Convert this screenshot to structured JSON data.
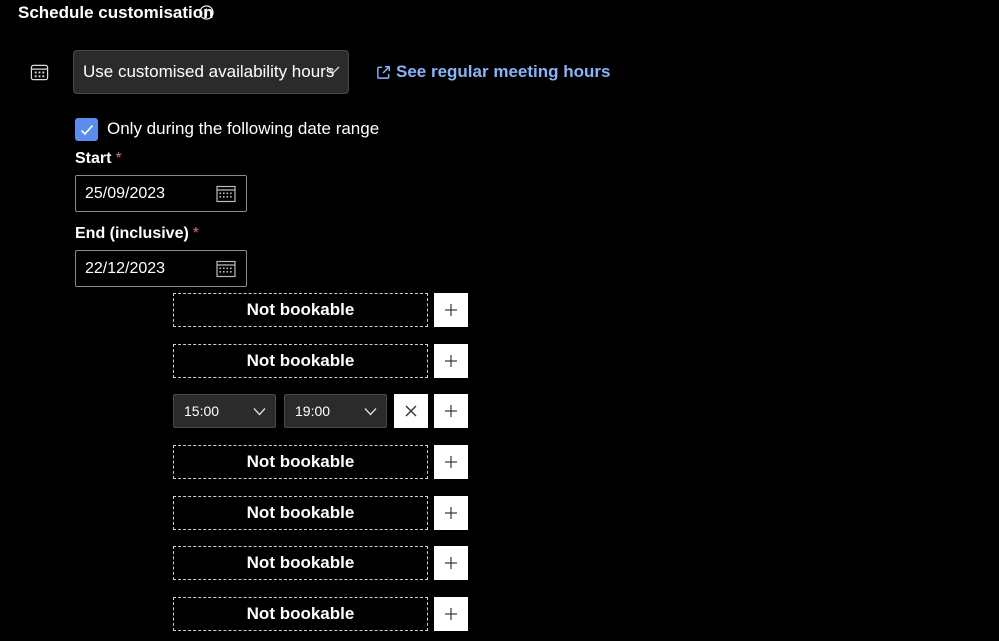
{
  "header": {
    "title": "Schedule customisation",
    "info_icon": "info-icon"
  },
  "availability": {
    "dropdown_value": "Use customised availability hours",
    "link_label": "See regular meeting hours",
    "link_icon": "open-external-icon",
    "link_color": "#8ab4f8"
  },
  "date_range": {
    "checkbox_label": "Only during the following date range",
    "checked": true,
    "start_label": "Start",
    "end_label": "End (inclusive)",
    "required_marker": "*",
    "start_value": "25/09/2023",
    "end_value": "22/12/2023"
  },
  "slots": [
    {
      "label": "Not bookable"
    },
    {
      "label": "Not bookable"
    },
    {
      "from": "15:00",
      "to": "19:00"
    },
    {
      "label": "Not bookable"
    },
    {
      "label": "Not bookable"
    },
    {
      "label": "Not bookable"
    },
    {
      "label": "Not bookable"
    }
  ]
}
